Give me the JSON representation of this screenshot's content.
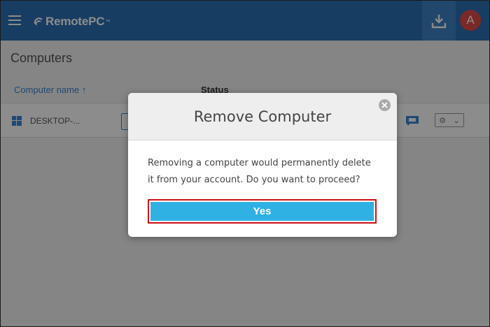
{
  "header": {
    "brand": "RemotePC",
    "brand_mark": "™",
    "avatar_initial": "A",
    "menu_icon": "hamburger-icon",
    "download_icon": "download-icon"
  },
  "page": {
    "title": "Computers"
  },
  "table": {
    "columns": [
      {
        "label": "Computer name ↑"
      },
      {
        "label": "Status"
      }
    ],
    "rows": [
      {
        "name": "DESKTOP-...",
        "os_icon": "windows-icon"
      }
    ]
  },
  "modal": {
    "title": "Remove Computer",
    "message": "Removing a computer would permanently delete it from your account. Do you want to proceed?",
    "confirm_label": "Yes",
    "close_icon": "close-icon"
  },
  "colors": {
    "header_bg": "#2b6fb3",
    "accent": "#2fb1e3",
    "highlight": "#d0101a",
    "avatar_bg": "#e04a4a"
  }
}
